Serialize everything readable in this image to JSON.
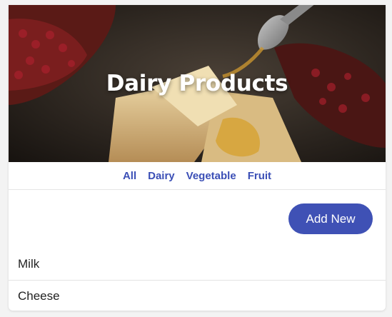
{
  "hero": {
    "title": "Dairy Products"
  },
  "filters": {
    "items": [
      "All",
      "Dairy",
      "Vegetable",
      "Fruit"
    ]
  },
  "actions": {
    "add_new_label": "Add New"
  },
  "list": {
    "items": [
      "Milk",
      "Cheese"
    ]
  },
  "colors": {
    "accent": "#3f51b5",
    "filter_text": "#3b4fb6"
  }
}
